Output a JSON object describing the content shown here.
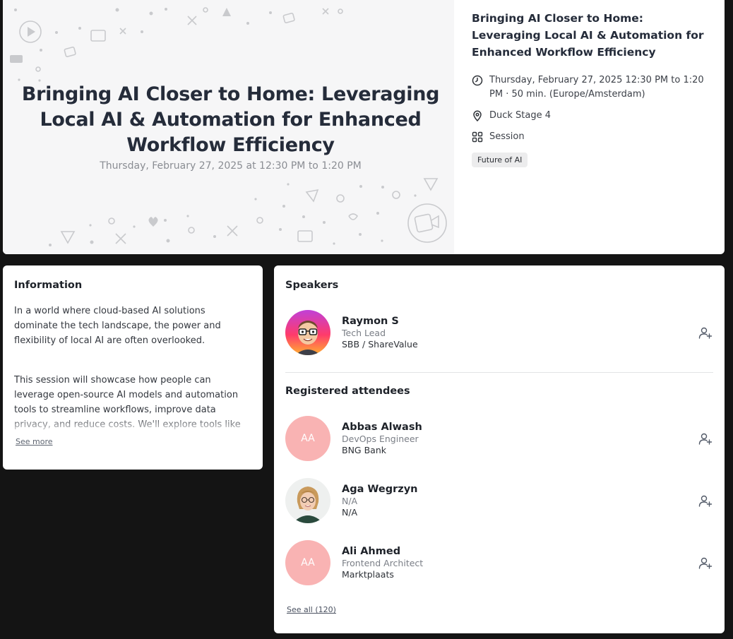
{
  "session": {
    "banner_title": "Bringing AI Closer to Home: Leveraging Local AI & Automation for Enhanced Workflow Efficiency",
    "banner_date": "Thursday, February 27, 2025 at 12:30 PM to 1:20 PM",
    "title": "Bringing AI Closer to Home: Leveraging Local AI & Automation for Enhanced Workflow Efficiency",
    "datetime": "Thursday, February 27, 2025 12:30 PM to 1:20 PM · 50 min. (Europe/Amsterdam)",
    "location": "Duck Stage 4",
    "type": "Session",
    "tag": "Future of AI"
  },
  "information": {
    "heading": "Information",
    "paragraph_1": "In a world where cloud-based AI solutions dominate the tech landscape, the power and flexibility of local AI are often overlooked.",
    "paragraph_2": "This session will showcase how people can leverage open-source AI models and automation tools to streamline workflows, improve data privacy, and reduce costs. We'll explore tools like Ollama, Open Web UI, and",
    "see_more": "See more"
  },
  "speakers": {
    "heading": "Speakers",
    "items": [
      {
        "name": "Raymon S",
        "role": "Tech Lead",
        "org": "SBB / ShareValue"
      }
    ]
  },
  "attendees": {
    "heading": "Registered attendees",
    "items": [
      {
        "initials": "AA",
        "name": "Abbas Alwash",
        "role": "DevOps Engineer",
        "org": "BNG Bank"
      },
      {
        "name": "Aga Wegrzyn",
        "role": "N/A",
        "org": "N/A"
      },
      {
        "initials": "AA",
        "name": "Ali Ahmed",
        "role": "Frontend Architect",
        "org": "Marktplaats"
      }
    ],
    "see_all": "See all (120)"
  },
  "icons": {
    "datetime": "clock-icon",
    "location": "map-pin-icon",
    "type": "grid-icon",
    "follow": "user-plus-icon"
  },
  "colors": {
    "page_background": "#141414",
    "card_background": "#ffffff",
    "initials_avatar": "#f9b3b3",
    "tag_background": "#ececed"
  }
}
